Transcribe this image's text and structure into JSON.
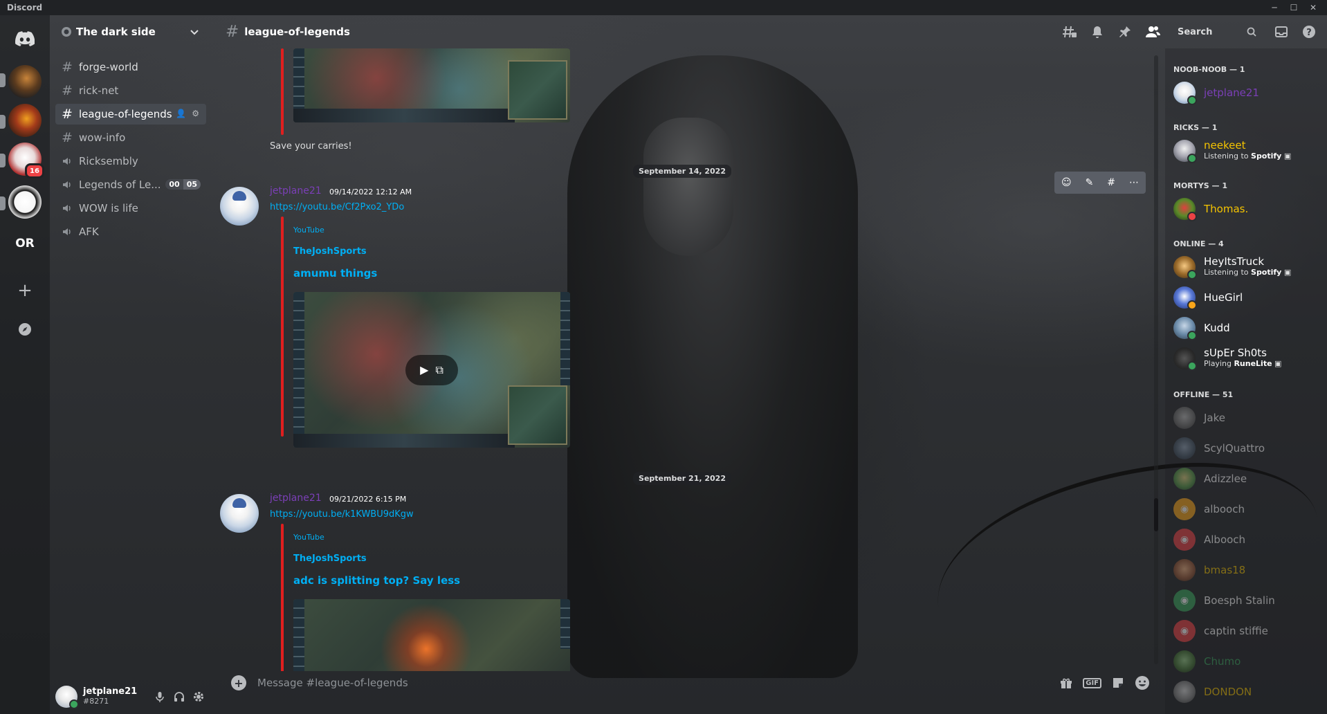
{
  "window": {
    "title": "Discord"
  },
  "server": {
    "name": "The dark side"
  },
  "rail": {
    "badge": "16",
    "or_label": "OR"
  },
  "channels": [
    {
      "name": "forge-world",
      "type": "text"
    },
    {
      "name": "rick-net",
      "type": "text"
    },
    {
      "name": "league-of-legends",
      "type": "text",
      "active": true
    },
    {
      "name": "wow-info",
      "type": "text"
    },
    {
      "name": "Ricksembly",
      "type": "voice"
    },
    {
      "name": "Legends of Le...",
      "type": "voice",
      "count_a": "00",
      "count_b": "05"
    },
    {
      "name": "WOW is life",
      "type": "voice"
    },
    {
      "name": "AFK",
      "type": "voice"
    }
  ],
  "user": {
    "name": "jetplane21",
    "tag": "#8271"
  },
  "header": {
    "channel": "league-of-legends",
    "search_placeholder": "Search"
  },
  "messages": {
    "prev_text": "Save your carries!",
    "date1": "September 14, 2022",
    "date2": "September 21, 2022",
    "m1": {
      "author": "jetplane21",
      "time": "09/14/2022 12:12 AM",
      "link": "https://youtu.be/Cf2Pxo2_YDo",
      "provider": "YouTube",
      "embed_author": "TheJoshSports",
      "embed_title": "amumu things"
    },
    "m2": {
      "author": "jetplane21",
      "time": "09/21/2022 6:15 PM",
      "link": "https://youtu.be/k1KWBU9dKgw",
      "provider": "YouTube",
      "embed_author": "TheJoshSports",
      "embed_title": "adc is splitting top? Say less"
    }
  },
  "composer": {
    "placeholder": "Message #league-of-legends",
    "gif_label": "GIF"
  },
  "members": {
    "groups": [
      {
        "title": "NOOB-NOOB — 1"
      },
      {
        "title": "RICKS — 1"
      },
      {
        "title": "MORTYS — 1"
      },
      {
        "title": "ONLINE — 4"
      },
      {
        "title": "OFFLINE — 51"
      }
    ],
    "list": [
      {
        "name": "jetplane21",
        "color": "#7b3fb7"
      },
      {
        "name": "neekeet",
        "color": "#f5c400",
        "activity_prefix": "Listening to ",
        "activity": "Spotify"
      },
      {
        "name": "Thomas.",
        "color": "#f5c400"
      },
      {
        "name": "HeyItsTruck",
        "color": "#ffffff",
        "activity_prefix": "Listening to ",
        "activity": "Spotify"
      },
      {
        "name": "HueGirl",
        "color": "#ffffff"
      },
      {
        "name": "Kudd",
        "color": "#ffffff"
      },
      {
        "name": "sUpEr Sh0ts",
        "color": "#ffffff",
        "activity_prefix": "Playing ",
        "activity": "RuneLite"
      },
      {
        "name": "Jake",
        "color": "#ffffff"
      },
      {
        "name": "ScylQuattro",
        "color": "#ffffff"
      },
      {
        "name": "Adizzlee",
        "color": "#ffffff"
      },
      {
        "name": "albooch",
        "color": "#ffffff"
      },
      {
        "name": "Albooch",
        "color": "#ffffff"
      },
      {
        "name": "bmas18",
        "color": "#f5c400"
      },
      {
        "name": "Boesph Stalin",
        "color": "#ffffff"
      },
      {
        "name": "captin stiffie",
        "color": "#ffffff"
      },
      {
        "name": "Chumo",
        "color": "#3ba55d"
      },
      {
        "name": "DONDON",
        "color": "#f5c400"
      }
    ]
  },
  "colors": {
    "accent_link": "#00aff4",
    "embed_bar": "#e01f1f",
    "online": "#3ba55d",
    "dnd": "#ed4245"
  }
}
